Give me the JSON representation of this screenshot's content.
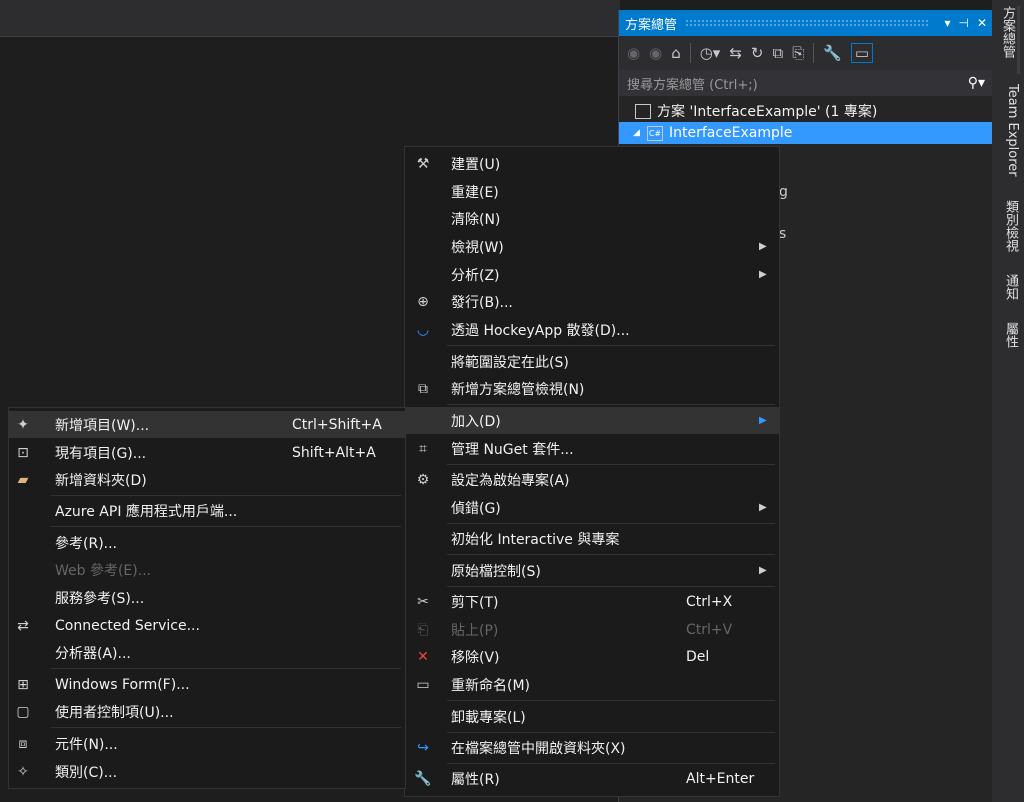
{
  "solution_explorer": {
    "title": "方案總管",
    "title_controls": [
      "▾",
      "⊣",
      "✕"
    ],
    "search_placeholder": "搜尋方案總管 (Ctrl+;)",
    "search_icon": "magnifier-icon",
    "tree": [
      {
        "label": "方案 'InterfaceExample' (1 專案)",
        "icon": "solution-icon"
      },
      {
        "label": "InterfaceExample",
        "icon": "csharp-project-icon",
        "selected": true
      }
    ],
    "partial_texts": [
      "g",
      "s"
    ]
  },
  "side_tabs": [
    "方案總管",
    "Team Explorer",
    "類別檢視",
    "通知",
    "屬性"
  ],
  "context_menu": {
    "items": [
      {
        "label": "建置(U)",
        "icon": "build-icon"
      },
      {
        "label": "重建(E)"
      },
      {
        "label": "清除(N)"
      },
      {
        "label": "檢視(W)",
        "submenu": true
      },
      {
        "label": "分析(Z)",
        "submenu": true
      },
      {
        "label": "發行(B)...",
        "icon": "publish-globe-icon"
      },
      {
        "label": "透過 HockeyApp 散發(D)...",
        "icon": "hockeyapp-icon"
      },
      {
        "label": "將範圍設定在此(S)"
      },
      {
        "label": "新增方案總管檢視(N)",
        "icon": "new-view-icon"
      },
      {
        "label": "加入(D)",
        "submenu": true,
        "highlighted": true
      },
      {
        "label": "管理 NuGet 套件...",
        "icon": "nuget-icon"
      },
      {
        "label": "設定為啟始專案(A)",
        "icon": "gear-icon"
      },
      {
        "label": "偵錯(G)",
        "submenu": true
      },
      {
        "label": "初始化 Interactive 與專案"
      },
      {
        "label": "原始檔控制(S)",
        "submenu": true
      },
      {
        "label": "剪下(T)",
        "shortcut": "Ctrl+X",
        "icon": "scissors-icon"
      },
      {
        "label": "貼上(P)",
        "shortcut": "Ctrl+V",
        "icon": "paste-icon",
        "disabled": true
      },
      {
        "label": "移除(V)",
        "shortcut": "Del",
        "icon": "delete-x-icon"
      },
      {
        "label": "重新命名(M)",
        "icon": "rename-icon"
      },
      {
        "label": "卸載專案(L)"
      },
      {
        "label": "在檔案總管中開啟資料夾(X)",
        "icon": "open-folder-arrow-icon"
      },
      {
        "label": "屬性(R)",
        "shortcut": "Alt+Enter",
        "icon": "wrench-icon"
      }
    ]
  },
  "add_submenu": {
    "items": [
      {
        "label": "新增項目(W)...",
        "shortcut": "Ctrl+Shift+A",
        "icon": "new-item-icon",
        "highlighted": true
      },
      {
        "label": "現有項目(G)...",
        "shortcut": "Shift+Alt+A",
        "icon": "existing-item-icon"
      },
      {
        "label": "新增資料夾(D)",
        "icon": "new-folder-icon"
      },
      {
        "label": "Azure API 應用程式用戶端..."
      },
      {
        "label": "參考(R)..."
      },
      {
        "label": "Web 參考(E)...",
        "disabled": true
      },
      {
        "label": "服務參考(S)..."
      },
      {
        "label": "Connected Service...",
        "icon": "connected-service-icon"
      },
      {
        "label": "分析器(A)..."
      },
      {
        "label": "Windows Form(F)...",
        "icon": "windows-form-icon"
      },
      {
        "label": "使用者控制項(U)...",
        "icon": "user-control-icon"
      },
      {
        "label": "元件(N)...",
        "icon": "component-icon"
      },
      {
        "label": "類別(C)...",
        "icon": "class-icon"
      }
    ]
  }
}
